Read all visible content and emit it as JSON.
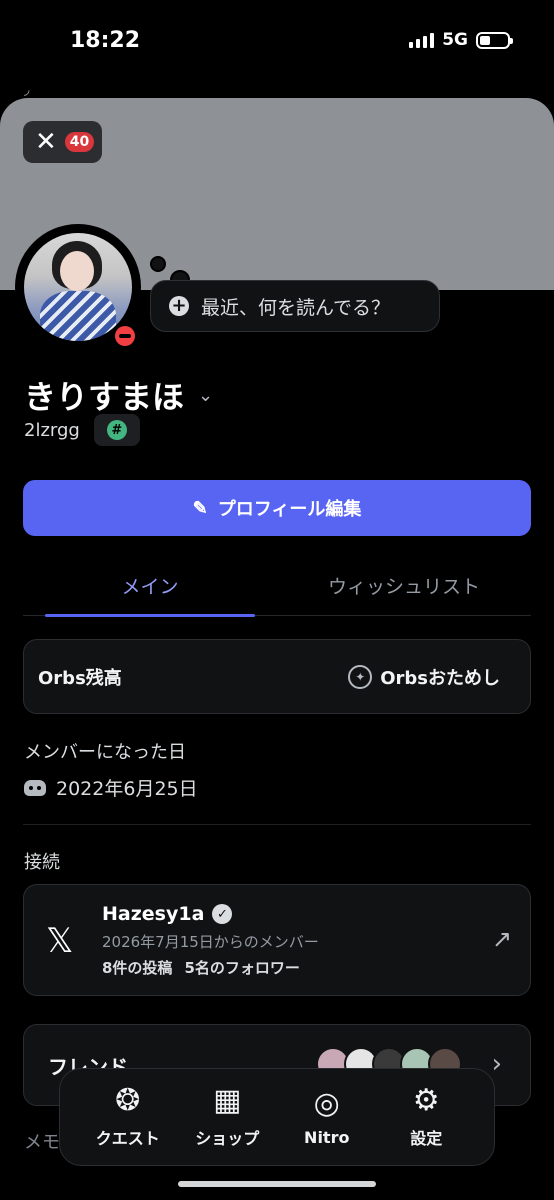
{
  "status_bar": {
    "time": "18:22",
    "network": "5G"
  },
  "banner": {
    "notification_count": "40"
  },
  "status_bubble": {
    "text": "最近、何を読んでる？"
  },
  "profile": {
    "display_name": "きりすまほ",
    "username": "2lzrgg",
    "tag_icon": "#",
    "edit_button": "プロフィール編集"
  },
  "tabs": [
    {
      "label": "メイン",
      "active": true
    },
    {
      "label": "ウィッシュリスト",
      "active": false
    }
  ],
  "orbs": {
    "balance_label": "Orbs残高",
    "try_label": "Orbsおためし"
  },
  "member_since": {
    "title": "メンバーになった日",
    "date": "2022年6月25日"
  },
  "connections": {
    "title": "接続",
    "items": [
      {
        "service_icon": "x-logo-icon",
        "name": "Hazesy1a",
        "since": "2026年7月15日からのメンバー",
        "posts": "8件の投稿",
        "followers": "5名のフォロワー"
      }
    ]
  },
  "friends": {
    "label": "フレンド",
    "avatar_colors": [
      "#c9a8b5",
      "#e5e5e5",
      "#3a3a3a",
      "#a7c4b5",
      "#5a4a45"
    ]
  },
  "memo_label": "メモ",
  "bottom_nav": [
    {
      "label": "クエスト",
      "icon": "quest-icon"
    },
    {
      "label": "ショップ",
      "icon": "shop-icon"
    },
    {
      "label": "Nitro",
      "icon": "nitro-icon"
    },
    {
      "label": "設定",
      "icon": "settings-icon"
    }
  ],
  "colors": {
    "accent": "#5865f2",
    "dnd": "#f23f43",
    "badge": "#da373c"
  }
}
